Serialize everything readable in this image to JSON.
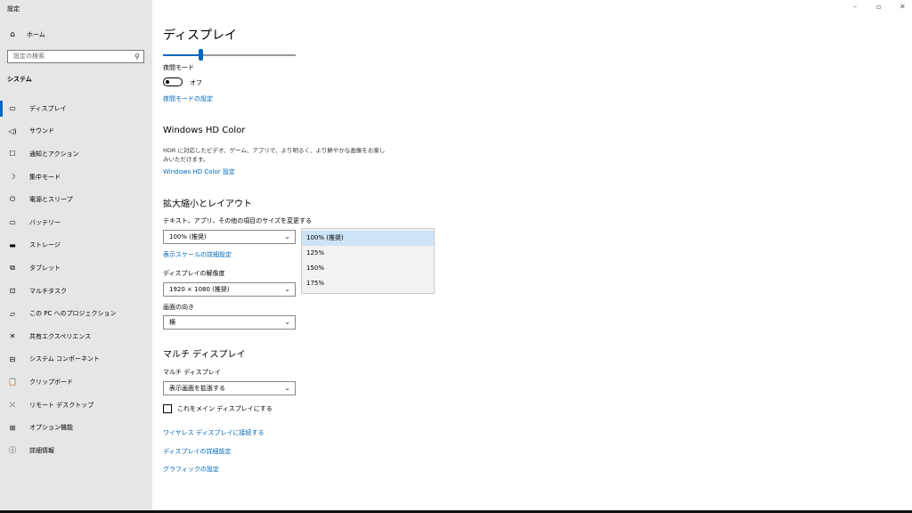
{
  "app": {
    "title": "設定"
  },
  "window_controls": {
    "minimize": "–",
    "maximize": "▫",
    "close": "✕"
  },
  "sidebar": {
    "home": {
      "icon": "home-icon",
      "glyph": "⌂",
      "label": "ホーム"
    },
    "search": {
      "placeholder": "設定の検索",
      "icon": "search-icon",
      "glyph": "⚲"
    },
    "section": "システム",
    "items": [
      {
        "icon": "display-icon",
        "glyph": "▭",
        "label": "ディスプレイ",
        "active": true
      },
      {
        "icon": "speaker-icon",
        "glyph": "◁)",
        "label": "サウンド"
      },
      {
        "icon": "notification-icon",
        "glyph": "☐",
        "label": "通知とアクション"
      },
      {
        "icon": "moon-icon",
        "glyph": "☽",
        "label": "集中モード"
      },
      {
        "icon": "power-icon",
        "glyph": "⏻",
        "label": "電源とスリープ"
      },
      {
        "icon": "battery-icon",
        "glyph": "▭",
        "label": "バッテリー"
      },
      {
        "icon": "storage-icon",
        "glyph": "▬",
        "label": "ストレージ"
      },
      {
        "icon": "tablet-icon",
        "glyph": "⧉",
        "label": "タブレット"
      },
      {
        "icon": "multitask-icon",
        "glyph": "⊡",
        "label": "マルチタスク"
      },
      {
        "icon": "project-icon",
        "glyph": "▱",
        "label": "この PC へのプロジェクション"
      },
      {
        "icon": "shared-experience-icon",
        "glyph": "✕",
        "label": "共有エクスペリエンス"
      },
      {
        "icon": "components-icon",
        "glyph": "⊟",
        "label": "システム コンポーネント"
      },
      {
        "icon": "clipboard-icon",
        "glyph": "📋",
        "label": "クリップボード"
      },
      {
        "icon": "remote-desktop-icon",
        "glyph": "⤫",
        "label": "リモート デスクトップ"
      },
      {
        "icon": "optional-features-icon",
        "glyph": "⊞",
        "label": "オプション機能"
      },
      {
        "icon": "info-icon",
        "glyph": "ⓘ",
        "label": "詳細情報"
      }
    ]
  },
  "main": {
    "title": "ディスプレイ",
    "brightness": {
      "value_percent": 28
    },
    "night_light": {
      "label": "夜間モード",
      "state": "オフ",
      "settings_link": "夜間モードの設定"
    },
    "hdr": {
      "heading": "Windows HD Color",
      "description": "HDR に対応したビデオ、ゲーム、アプリで、より明るく、より鮮やかな画像をお楽しみいただけます。",
      "link": "Windows HD Color 設定"
    },
    "scale_layout": {
      "heading": "拡大縮小とレイアウト",
      "scale_label": "テキスト、アプリ、その他の項目のサイズを変更する",
      "scale_value": "100% (推奨)",
      "scale_options": [
        "100% (推奨)",
        "125%",
        "150%",
        "175%"
      ],
      "advanced_scale_link": "表示スケールの詳細設定",
      "resolution_label": "ディスプレイの解像度",
      "resolution_value": "1920 × 1080 (推奨)",
      "orientation_label": "画面の向き",
      "orientation_value": "横"
    },
    "multi_display": {
      "heading": "マルチ ディスプレイ",
      "label": "マルチ ディスプレイ",
      "value": "表示画面を拡張する",
      "main_display_checkbox": "これをメイン ディスプレイにする",
      "links": [
        "ワイヤレス ディスプレイに接続する",
        "ディスプレイの詳細設定",
        "グラフィックの設定"
      ]
    }
  }
}
